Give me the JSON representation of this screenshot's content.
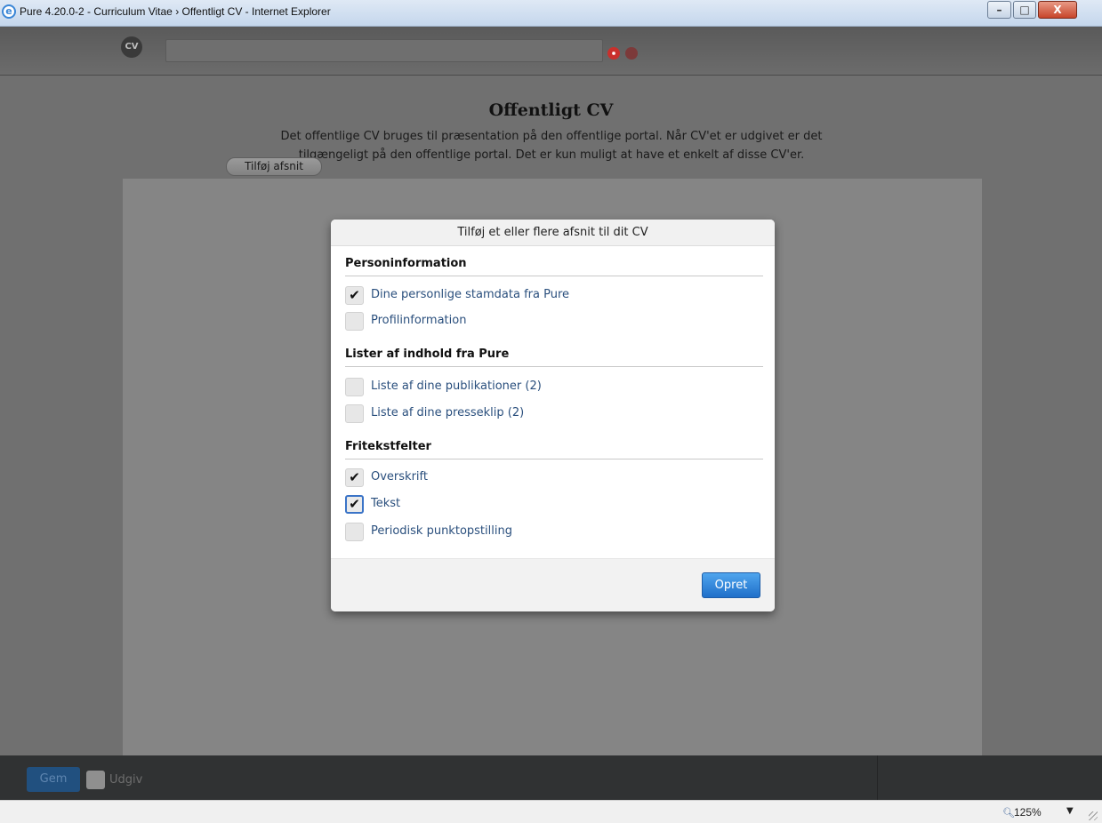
{
  "window": {
    "title": "Pure 4.20.0-2 - Curriculum Vitae › Offentligt CV - Internet Explorer",
    "min_glyph": "–",
    "max_glyph": "□",
    "close_glyph": "X"
  },
  "appbar": {
    "logo": "CV",
    "search_value": ""
  },
  "page": {
    "title": "Offentligt CV",
    "description_line1": "Det offentlige CV bruges til præsentation på den offentlige portal. Når CV'et er udgivet er det",
    "description_line2": "tilgængeligt på den offentlige portal. Det er kun muligt at have et enkelt af disse CV'er."
  },
  "add_section_button": "Tilføj afsnit",
  "modal": {
    "title": "Tilføj et eller flere afsnit til dit CV",
    "sections": [
      {
        "heading": "Personinformation",
        "options": [
          {
            "label": "Dine personlige stamdata fra Pure",
            "checked": true
          },
          {
            "label": "Profilinformation",
            "checked": false
          }
        ]
      },
      {
        "heading": "Lister af indhold fra Pure",
        "options": [
          {
            "label": "Liste af dine publikationer (2)",
            "checked": false
          },
          {
            "label": "Liste af dine presseklip (2)",
            "checked": false
          }
        ]
      },
      {
        "heading": "Fritekstfelter",
        "options": [
          {
            "label": "Overskrift",
            "checked": true
          },
          {
            "label": "Tekst",
            "checked": true
          },
          {
            "label": "Periodisk punktopstilling",
            "checked": false
          }
        ]
      }
    ],
    "create_button": "Opret",
    "check_glyph": "✔"
  },
  "bottombar": {
    "save_button": "Gem",
    "publish_label": "Udgiv",
    "publish_checked": false
  },
  "statusbar": {
    "zoom": "125%",
    "zoom_icon": "magnifier-icon",
    "zoom_arrow": "▼"
  },
  "colors": {
    "accent": "#2a74d2",
    "option_text": "#2a4f7d"
  }
}
